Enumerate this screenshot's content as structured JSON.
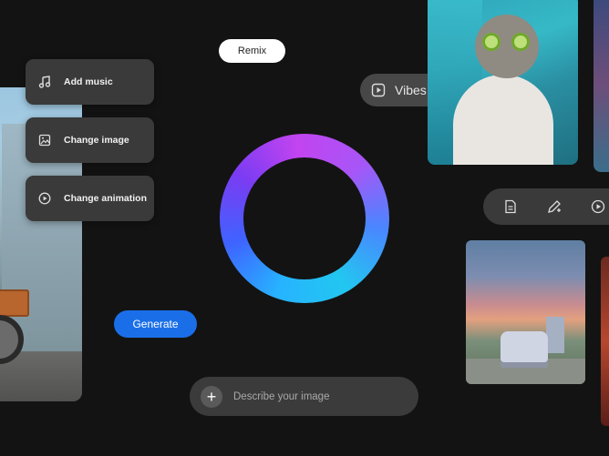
{
  "menu": {
    "items": [
      {
        "label": "Add music",
        "icon": "music-note-icon"
      },
      {
        "label": "Change image",
        "icon": "image-edit-icon"
      },
      {
        "label": "Change animation",
        "icon": "play-circle-icon"
      }
    ]
  },
  "remix": {
    "label": "Remix"
  },
  "vibes": {
    "label": "Vibes",
    "icon": "play-square-icon"
  },
  "generate": {
    "label": "Generate"
  },
  "prompt": {
    "placeholder": "Describe your image",
    "icon": "plus-icon"
  },
  "toolbar": {
    "icons": [
      "document-icon",
      "pencil-add-icon",
      "play-circle-icon"
    ]
  },
  "colors": {
    "accent": "#1a6fe8",
    "ring_start": "#27b3ff",
    "ring_mid": "#7a3cf2",
    "ring_end": "#c244f0"
  }
}
